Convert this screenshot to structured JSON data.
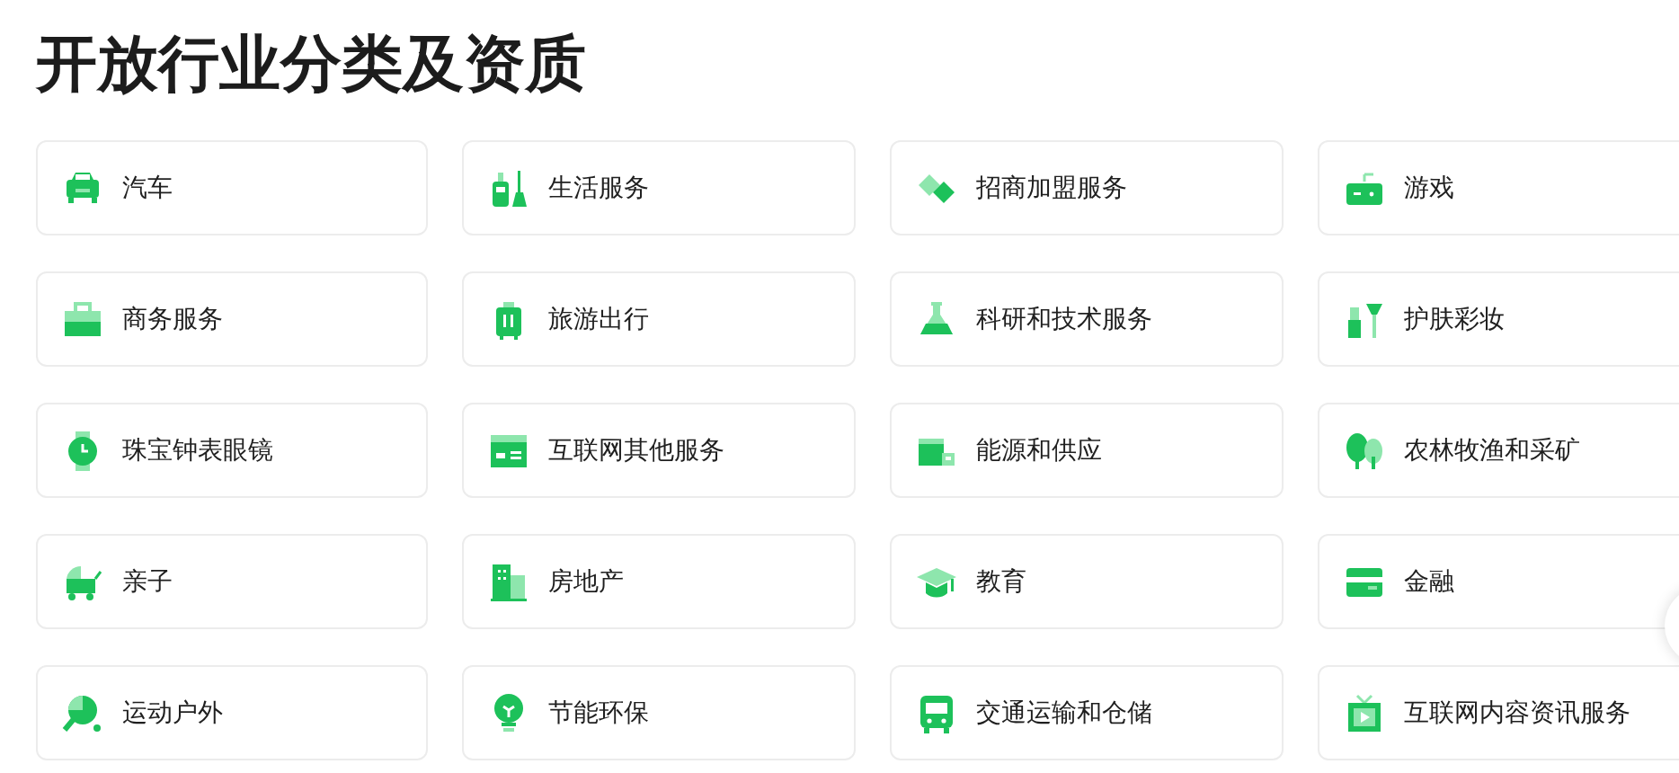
{
  "title": "开放行业分类及资质",
  "categories": [
    {
      "label": "汽车"
    },
    {
      "label": "生活服务"
    },
    {
      "label": "招商加盟服务"
    },
    {
      "label": "游戏"
    },
    {
      "label": "商务服务"
    },
    {
      "label": "旅游出行"
    },
    {
      "label": "科研和技术服务"
    },
    {
      "label": "护肤彩妆"
    },
    {
      "label": "珠宝钟表眼镜"
    },
    {
      "label": "互联网其他服务"
    },
    {
      "label": "能源和供应"
    },
    {
      "label": "农林牧渔和采矿"
    },
    {
      "label": "亲子"
    },
    {
      "label": "房地产"
    },
    {
      "label": "教育"
    },
    {
      "label": "金融"
    },
    {
      "label": "运动户外"
    },
    {
      "label": "节能环保"
    },
    {
      "label": "交通运输和仓储"
    },
    {
      "label": "互联网内容资讯服务"
    }
  ]
}
